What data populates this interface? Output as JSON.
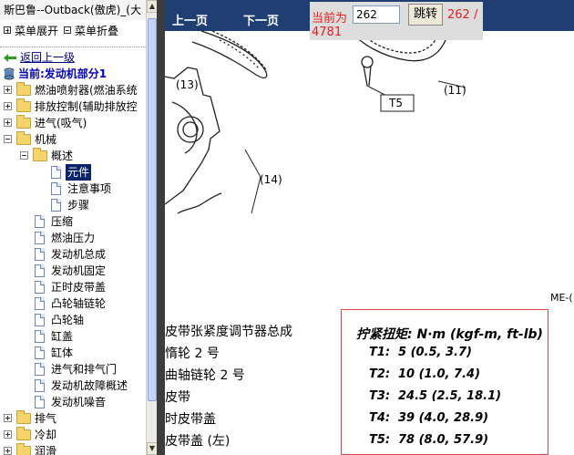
{
  "window": {
    "title": "斯巴鲁--Outback(傲虎)_(大"
  },
  "toolbar": {
    "expand_all": "菜单展开",
    "collapse_all": "菜单折叠"
  },
  "tree": {
    "back": "返回上一级",
    "current": "当前:发动机部分1",
    "items": [
      {
        "label": "燃油喷射器(燃油系统"
      },
      {
        "label": "排放控制(辅助排放控"
      },
      {
        "label": "进气(吸气)"
      },
      {
        "label": "机械"
      },
      {
        "label": "概述"
      },
      {
        "label": "元件"
      },
      {
        "label": "注意事项"
      },
      {
        "label": "步骤"
      },
      {
        "label": "压缩"
      },
      {
        "label": "燃油压力"
      },
      {
        "label": "发动机总成"
      },
      {
        "label": "发动机固定"
      },
      {
        "label": "正时皮带盖"
      },
      {
        "label": "凸轮轴链轮"
      },
      {
        "label": "凸轮轴"
      },
      {
        "label": "缸盖"
      },
      {
        "label": "缸体"
      },
      {
        "label": "进气和排气门"
      },
      {
        "label": "发动机故障概述"
      },
      {
        "label": "发动机噪音"
      },
      {
        "label": "排气"
      },
      {
        "label": "冷却"
      },
      {
        "label": "润滑"
      }
    ]
  },
  "nav": {
    "prev": "上一页",
    "next": "下一页",
    "current_label": "当前为",
    "page_value": "262",
    "jump": "跳转",
    "total_a": "262 /",
    "total_b": "4781"
  },
  "diagram": {
    "callouts": [
      "(13)",
      "T5",
      "(11)",
      "(14)"
    ],
    "ref": "ME-("
  },
  "spec_lines": [
    "皮带张紧度调节器总成",
    "惰轮 2 号",
    "曲轴链轮 2 号",
    "皮带",
    "时皮带盖",
    "皮带盖 (左)"
  ],
  "torque": {
    "title": "拧紧扭矩: N·m (kgf-m, ft-lb)",
    "rows": [
      {
        "code": "T1:",
        "value": "5 (0.5, 3.7)"
      },
      {
        "code": "T2:",
        "value": "10 (1.0, 7.4)"
      },
      {
        "code": "T3:",
        "value": "24.5 (2.5, 18.1)"
      },
      {
        "code": "T4:",
        "value": "39 (4.0, 28.9)"
      },
      {
        "code": "T5:",
        "value": "78 (8.0, 57.9)"
      }
    ]
  },
  "colors": {
    "nav_bg": "#1f3f72",
    "accent_red": "#e82020",
    "selected_bg": "#0a246a"
  }
}
